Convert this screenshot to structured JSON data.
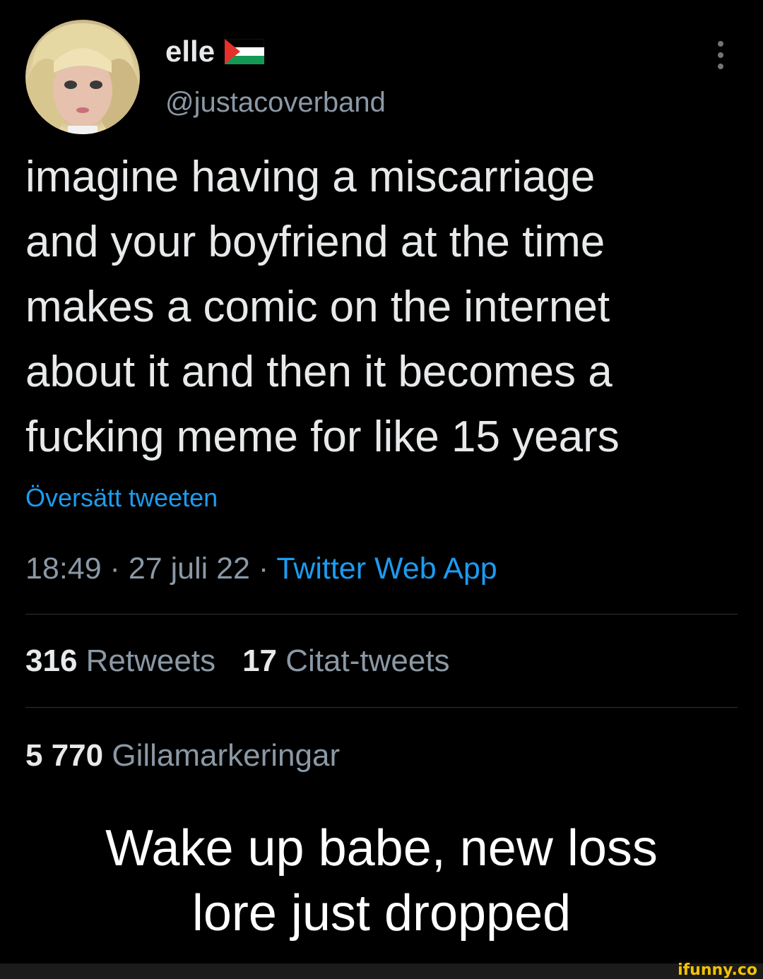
{
  "user": {
    "display_name": "elle",
    "flag_icon": "palestine-flag-icon",
    "handle": "@justacoverband"
  },
  "tweet": {
    "lines": [
      "imagine having a miscarriage",
      "and your boyfriend at the time",
      "makes a comic on the internet",
      "about it and then it becomes a",
      "fucking meme for like 15 years"
    ],
    "translate_link": "Översätt tweeten",
    "time": "18:49",
    "sep1": " · ",
    "date": "27 juli 22",
    "sep2": " · ",
    "source": "Twitter Web App"
  },
  "stats": {
    "retweets_count": "316",
    "retweets_label": "Retweets",
    "quotes_count": "17",
    "quotes_label": "Citat-tweets",
    "likes_count": "5 770",
    "likes_label": "Gillamarkeringar"
  },
  "caption": {
    "line1": "Wake up babe, new loss",
    "line2": "lore just dropped"
  },
  "watermark": "ifunny.co",
  "colors": {
    "background": "#000000",
    "text": "#e7e9ea",
    "secondary": "#8b98a5",
    "link": "#1d9bf0",
    "divider": "#2f3336",
    "watermark": "#f2c200"
  }
}
